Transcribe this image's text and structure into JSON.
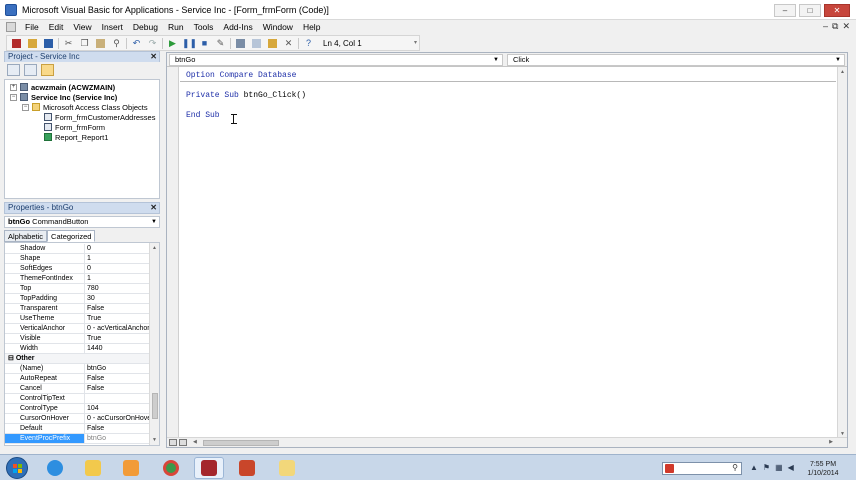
{
  "window": {
    "title": "Microsoft Visual Basic for Applications - Service Inc - [Form_frmForm (Code)]",
    "controls": [
      "–",
      "□",
      "✕"
    ]
  },
  "menu": {
    "items": [
      "File",
      "Edit",
      "View",
      "Insert",
      "Debug",
      "Run",
      "Tools",
      "Add-Ins",
      "Window",
      "Help"
    ],
    "mdi_controls": [
      "–",
      "⧉",
      "✕"
    ]
  },
  "toolbar": {
    "position_text": "Ln 4, Col 1"
  },
  "project_panel": {
    "title": "Project - Service Inc",
    "close": "✕",
    "tree": [
      {
        "label": "acwzmain (ACWZMAIN)",
        "icon": "project-icon"
      },
      {
        "label": "Service Inc (Service Inc)",
        "icon": "project-icon"
      },
      {
        "label": "Microsoft Access Class Objects",
        "icon": "folder-icon"
      },
      {
        "label": "Form_frmCustomerAddresses",
        "icon": "form-icon"
      },
      {
        "label": "Form_frmForm",
        "icon": "form-icon"
      },
      {
        "label": "Report_Report1",
        "icon": "report-icon"
      }
    ]
  },
  "properties_panel": {
    "title": "Properties - btnGo",
    "close": "✕",
    "object_name": "btnGo",
    "object_type": "CommandButton",
    "tabs": [
      "Alphabetic",
      "Categorized"
    ],
    "rows": [
      {
        "name": "Shadow",
        "value": "0"
      },
      {
        "name": "Shape",
        "value": "1"
      },
      {
        "name": "SoftEdges",
        "value": "0"
      },
      {
        "name": "ThemeFontIndex",
        "value": "1"
      },
      {
        "name": "Top",
        "value": "780"
      },
      {
        "name": "TopPadding",
        "value": "30"
      },
      {
        "name": "Transparent",
        "value": "False"
      },
      {
        "name": "UseTheme",
        "value": "True"
      },
      {
        "name": "VerticalAnchor",
        "value": "0 - acVerticalAnchor"
      },
      {
        "name": "Visible",
        "value": "True"
      },
      {
        "name": "Width",
        "value": "1440"
      },
      {
        "name": "Other",
        "value": ""
      },
      {
        "name": "(Name)",
        "value": "btnGo"
      },
      {
        "name": "AutoRepeat",
        "value": "False"
      },
      {
        "name": "Cancel",
        "value": "False"
      },
      {
        "name": "ControlTipText",
        "value": ""
      },
      {
        "name": "ControlType",
        "value": "104"
      },
      {
        "name": "CursorOnHover",
        "value": "0 - acCursorOnHove"
      },
      {
        "name": "Default",
        "value": "False"
      },
      {
        "name": "EventProcPrefix",
        "value": "btnGo"
      }
    ]
  },
  "code_window": {
    "object_combo": "btnGo",
    "procedure_combo": "Click",
    "lines": [
      {
        "kw": "Option Compare Database",
        "rest": ""
      },
      {
        "kw": "Private Sub",
        "rest": " btnGo_Click()"
      },
      {
        "kw": "End Sub",
        "rest": ""
      }
    ]
  },
  "taskbar": {
    "apps": [
      "internet-explorer-icon",
      "file-explorer-icon",
      "media-player-icon",
      "chrome-icon",
      "access-icon",
      "powerpoint-icon",
      "folder-icon"
    ],
    "time": "7:55 PM",
    "date": "1/10/2014"
  },
  "colors": {
    "keyword": "#1e2fa8",
    "selection": "#3399ff"
  }
}
